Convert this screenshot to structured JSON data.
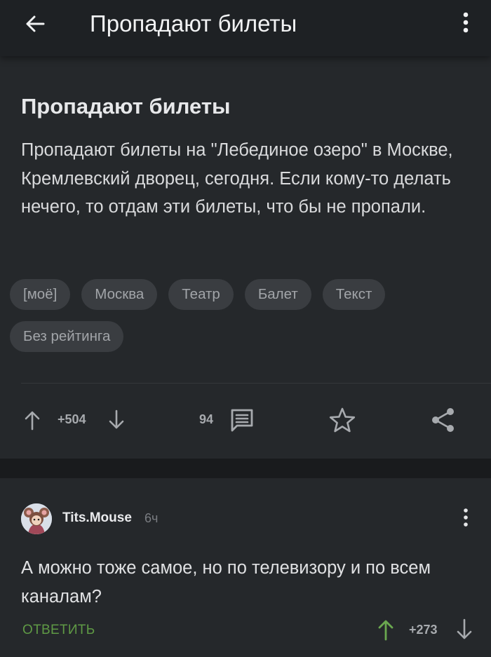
{
  "appbar": {
    "title": "Пропадают билеты",
    "back_icon": "arrow-left-icon",
    "more_icon": "more-vertical-icon"
  },
  "post": {
    "title": "Пропадают билеты",
    "body": "Пропадают билеты на \"Лебединое озеро\" в Москве, Кремлевский дворец, сегодня. Если кому-то делать нечего, то отдам эти билеты, что бы не пропали.",
    "tags": [
      "[моё]",
      "Москва",
      "Театр",
      "Балет",
      "Текст",
      "Без рейтинга"
    ],
    "rating": "+504",
    "comments_count": "94",
    "icons": {
      "upvote": "arrow-up-icon",
      "downvote": "arrow-down-icon",
      "comments": "comment-icon",
      "save": "star-icon",
      "share": "share-icon"
    }
  },
  "comment": {
    "username": "Tits.Mouse",
    "time": "6ч",
    "text": "А можно тоже самое, но по телевизору и по всем каналам?",
    "reply_label": "ОТВЕТИТЬ",
    "rating": "+273"
  },
  "colors": {
    "background": "#25282b",
    "appbar": "#1e2124",
    "tag_bg": "#3a3d41",
    "reply_green": "#5f9a45",
    "upvote_green": "#6aa84f"
  }
}
